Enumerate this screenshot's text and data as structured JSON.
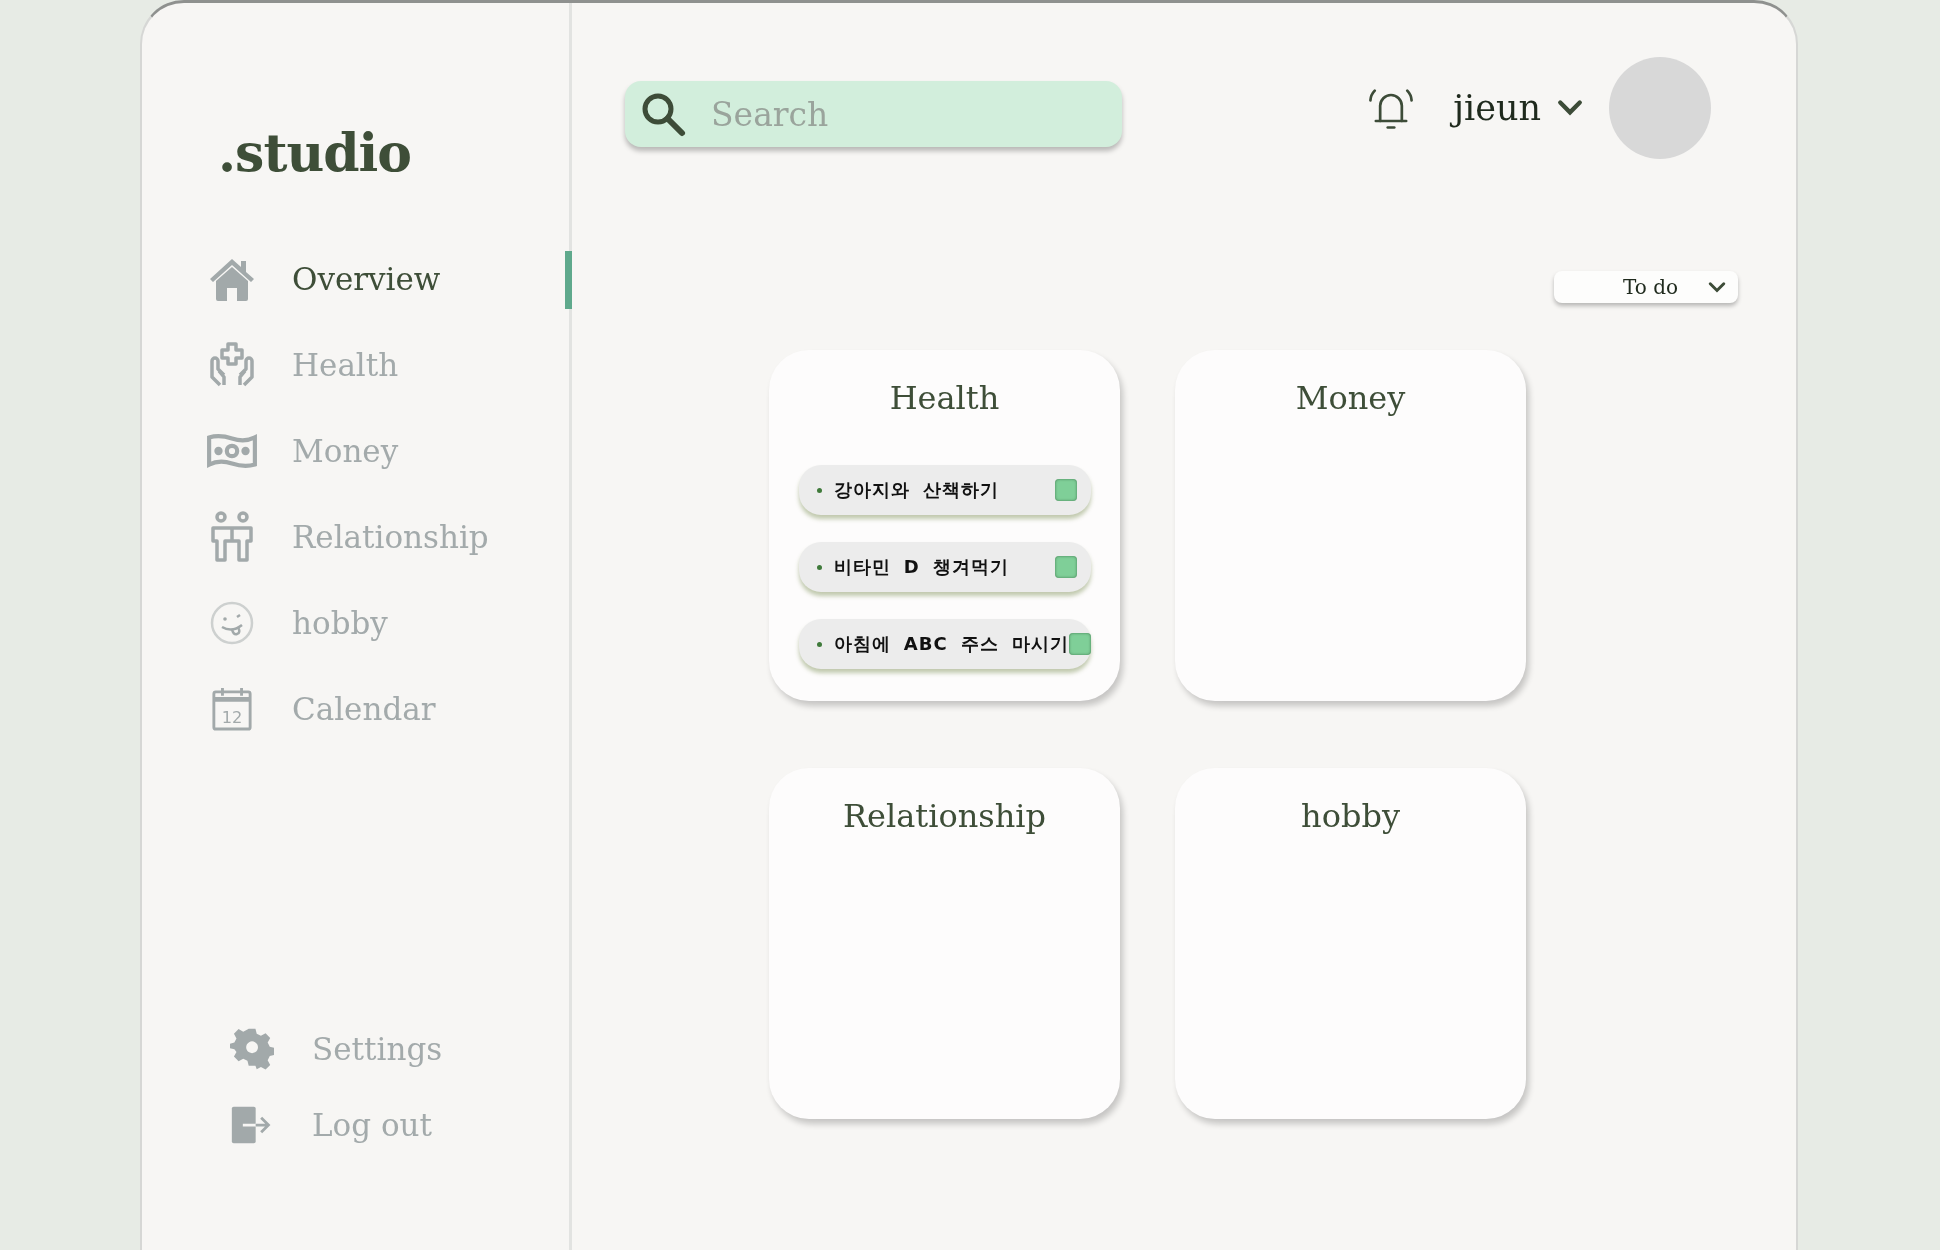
{
  "brand": ".studio",
  "nav": [
    {
      "label": "Overview",
      "selected": true
    },
    {
      "label": "Health",
      "selected": false
    },
    {
      "label": "Money",
      "selected": false
    },
    {
      "label": "Relationship",
      "selected": false
    },
    {
      "label": "hobby",
      "selected": false
    },
    {
      "label": "Calendar",
      "selected": false,
      "calendar_day": "12"
    }
  ],
  "footer_nav": [
    {
      "label": "Settings"
    },
    {
      "label": "Log out"
    }
  ],
  "search": {
    "placeholder": "Search"
  },
  "user": {
    "name": "jieun"
  },
  "filter": {
    "label": "To do"
  },
  "cards": [
    {
      "title": "Health",
      "todos": [
        {
          "text": "강아지와 산책하기",
          "checked": false
        },
        {
          "text": "비타민 D 챙겨먹기",
          "checked": false
        },
        {
          "text": "아침에 ABC 주스 마시기",
          "checked": false
        }
      ]
    },
    {
      "title": "Money"
    },
    {
      "title": "Relationship"
    },
    {
      "title": "hobby"
    }
  ]
}
